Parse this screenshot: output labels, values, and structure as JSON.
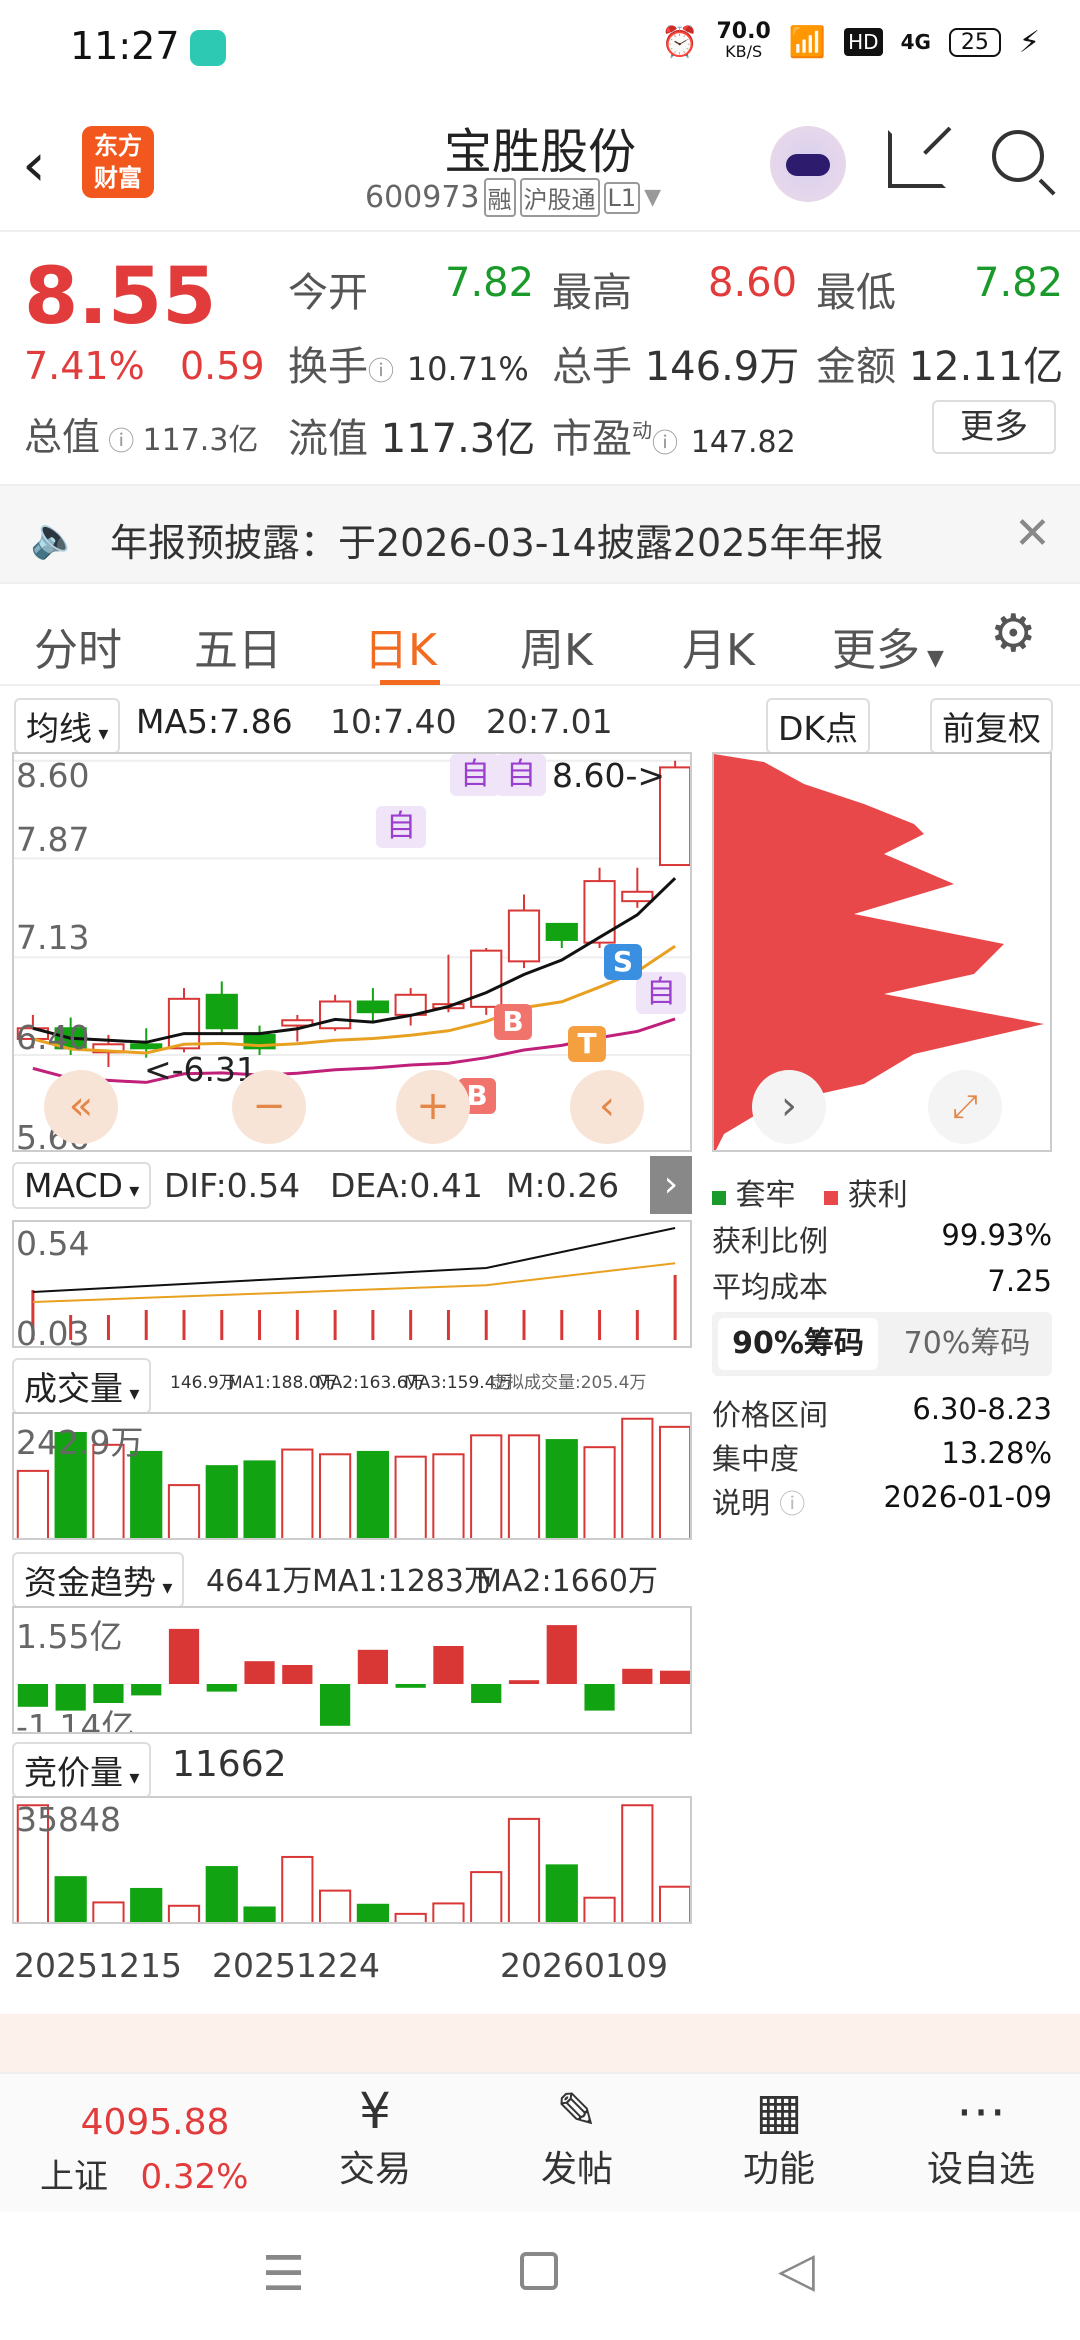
{
  "status_bar": {
    "time": "11:27",
    "net_speed": "70.0",
    "net_unit": "KB/S",
    "hd": "HD",
    "signal": "4G",
    "battery": "25"
  },
  "header": {
    "logo_line1": "东方",
    "logo_line2": "财富",
    "title": "宝胜股份",
    "code": "600973",
    "tag_rong": "融",
    "tag_hgt": "沪股通",
    "tag_level": "L1"
  },
  "quote": {
    "price": "8.55",
    "change_pct": "7.41%",
    "change": "0.59",
    "open_label": "今开",
    "open": "7.82",
    "high_label": "最高",
    "high": "8.60",
    "low_label": "最低",
    "low": "7.82",
    "turnover_label": "换手",
    "turnover": "10.71%",
    "volume_label": "总手",
    "volume": "146.9万",
    "amount_label": "金额",
    "amount": "12.11亿",
    "mktcap_label": "总值",
    "mktcap": "117.3亿",
    "float_label": "流值",
    "float": "117.3亿",
    "pe_label": "市盈",
    "pe_sup": "动",
    "pe": "147.82",
    "more": "更多"
  },
  "notice": {
    "text": "年报预披露：于2026-03-14披露2025年年报"
  },
  "tabs": [
    {
      "label": "分时"
    },
    {
      "label": "五日"
    },
    {
      "label": "日K"
    },
    {
      "label": "周K"
    },
    {
      "label": "月K"
    },
    {
      "label": "更多"
    }
  ],
  "kline": {
    "ma_select": "均线",
    "ma5": "MA5:7.86",
    "ma10": "10:7.40",
    "ma20": "20:7.01",
    "dk": "DK点",
    "adjust": "前复权",
    "y_labels": [
      "8.60",
      "7.87",
      "7.13",
      "6.40",
      "5.66"
    ],
    "high_note": "8.60->",
    "low_note": "<-6.31",
    "zi_marker": "自",
    "b_marker": "B",
    "s_marker": "S",
    "t_marker": "T"
  },
  "chip": {
    "legend_trapped": "套牢",
    "legend_profit": "获利",
    "rows": [
      {
        "label": "获利比例",
        "value": "99.93%"
      },
      {
        "label": "平均成本",
        "value": "7.25"
      }
    ],
    "tab_90": "90%筹码",
    "tab_70": "70%筹码",
    "rows2": [
      {
        "label": "价格区间",
        "value": "6.30-8.23"
      },
      {
        "label": "集中度",
        "value": "13.28%"
      },
      {
        "label": "说明",
        "value": "2026-01-09"
      }
    ]
  },
  "macd": {
    "name": "MACD",
    "dif": "DIF:0.54",
    "dea": "DEA:0.41",
    "m": "M:0.26",
    "top": "0.54",
    "bottom": "0.03"
  },
  "volume": {
    "name": "成交量",
    "v": "146.9万",
    "ma1": "MA1:188.0万",
    "ma2": "MA2:163.6万",
    "ma3": "MA3:159.4万",
    "virtual": "虚拟成交量:205.4万",
    "top": "242.9万"
  },
  "fund": {
    "name": "资金趋势",
    "v": "4641万",
    "ma1": "MA1:1283万",
    "ma2": "MA2:1660万",
    "top": "1.55亿",
    "bottom": "-1.14亿"
  },
  "auction": {
    "name": "竞价量",
    "v": "11662",
    "top": "35848"
  },
  "dates": [
    "20251215",
    "20251224",
    "20260109"
  ],
  "bottom_nav": {
    "index_value": "4095.88",
    "index_name": "上证",
    "index_pct": "0.32%",
    "items": [
      {
        "label": "交易"
      },
      {
        "label": "发帖"
      },
      {
        "label": "功能"
      },
      {
        "label": "设自选"
      }
    ]
  },
  "chart_data": {
    "type": "candlestick",
    "ohlc": [
      [
        6.52,
        6.7,
        6.45,
        6.6
      ],
      [
        6.6,
        6.68,
        6.4,
        6.45
      ],
      [
        6.42,
        6.55,
        6.31,
        6.48
      ],
      [
        6.48,
        6.6,
        6.38,
        6.45
      ],
      [
        6.45,
        6.9,
        6.42,
        6.82
      ],
      [
        6.85,
        6.95,
        6.55,
        6.6
      ],
      [
        6.55,
        6.62,
        6.4,
        6.45
      ],
      [
        6.62,
        6.7,
        6.5,
        6.66
      ],
      [
        6.6,
        6.85,
        6.58,
        6.8
      ],
      [
        6.8,
        6.9,
        6.65,
        6.72
      ],
      [
        6.7,
        6.9,
        6.62,
        6.85
      ],
      [
        6.75,
        7.15,
        6.72,
        6.78
      ],
      [
        6.76,
        7.2,
        6.7,
        7.18
      ],
      [
        7.1,
        7.6,
        7.05,
        7.48
      ],
      [
        7.38,
        7.32,
        7.2,
        7.26
      ],
      [
        7.24,
        7.8,
        7.2,
        7.7
      ],
      [
        7.55,
        7.8,
        7.5,
        7.62
      ],
      [
        7.82,
        8.6,
        7.82,
        8.55
      ]
    ],
    "macd_hist": [
      0.1,
      0.05,
      0.05,
      0.06,
      0.06,
      0.06,
      0.06,
      0.06,
      0.06,
      0.06,
      0.06,
      0.06,
      0.06,
      0.06,
      0.06,
      0.06,
      0.06,
      0.13
    ],
    "volume": [
      150,
      230,
      205,
      190,
      120,
      160,
      170,
      195,
      185,
      190,
      180,
      185,
      225,
      225,
      215,
      200,
      260,
      242.9
    ],
    "fund": [
      -0.6,
      -0.7,
      -0.5,
      -0.3,
      1.45,
      -0.2,
      0.6,
      0.5,
      -1.1,
      0.9,
      -0.1,
      1.0,
      -0.5,
      0.1,
      1.55,
      -0.7,
      0.4,
      0.35
    ],
    "auction": [
      35848,
      14500,
      7000,
      11000,
      6000,
      17500,
      5500,
      20500,
      10500,
      6300,
      3600,
      6700,
      16000,
      31800,
      18000,
      8400,
      35848,
      11662
    ]
  }
}
